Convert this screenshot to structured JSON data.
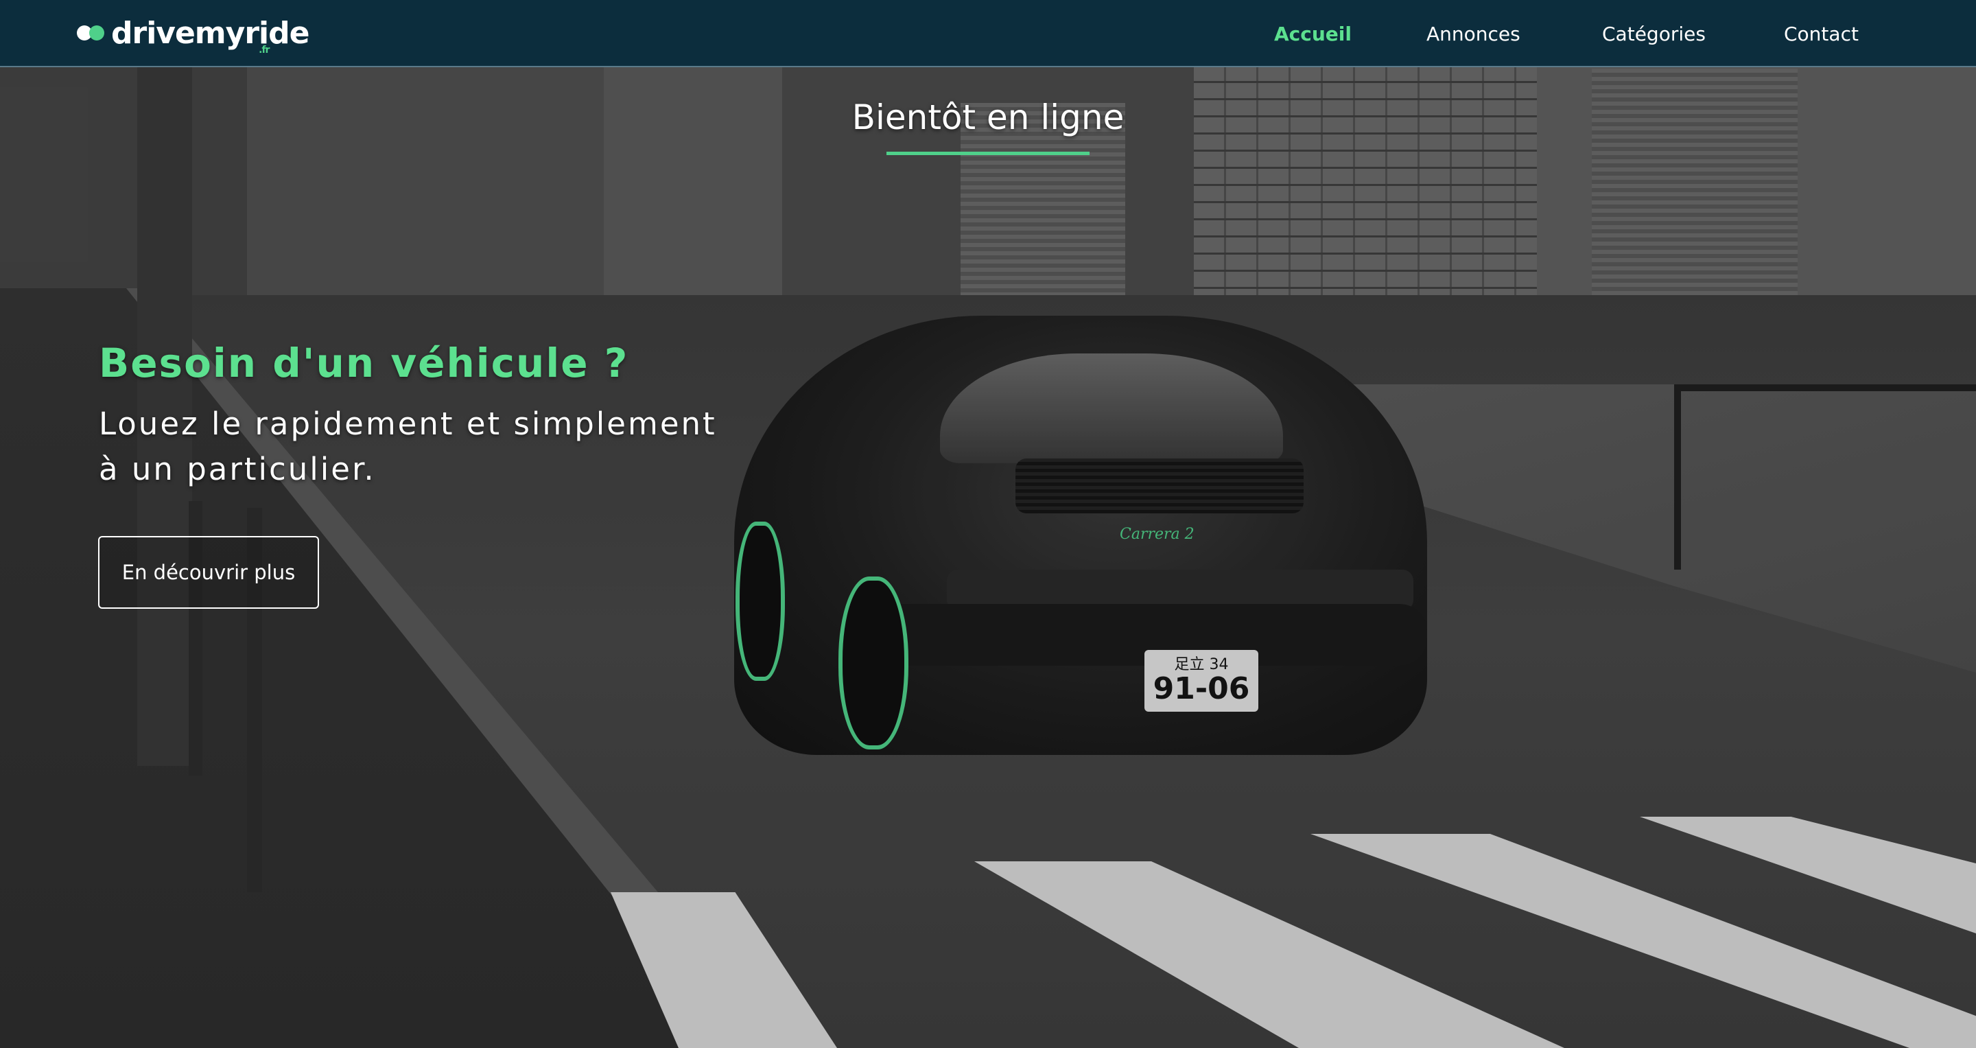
{
  "brand": {
    "name": "drivemyride",
    "tld": ".fr",
    "accent_color": "#5ce08f",
    "nav_bg_color": "#092c3e"
  },
  "nav": {
    "items": [
      {
        "label": "Accueil",
        "active": true
      },
      {
        "label": "Annonces",
        "active": false
      },
      {
        "label": "Catégories",
        "active": false
      },
      {
        "label": "Contact",
        "active": false
      }
    ]
  },
  "hero": {
    "coming_soon": "Bientôt en ligne",
    "title": "Besoin d'un véhicule ?",
    "subtitle_line1": "Louez le rapidement et simplement",
    "subtitle_line2": "à un particulier.",
    "cta_label": "En découvrir plus"
  },
  "background": {
    "plate_line1": "足立 34",
    "plate_line2": "91-06",
    "car_badge": "Carrera 2"
  }
}
